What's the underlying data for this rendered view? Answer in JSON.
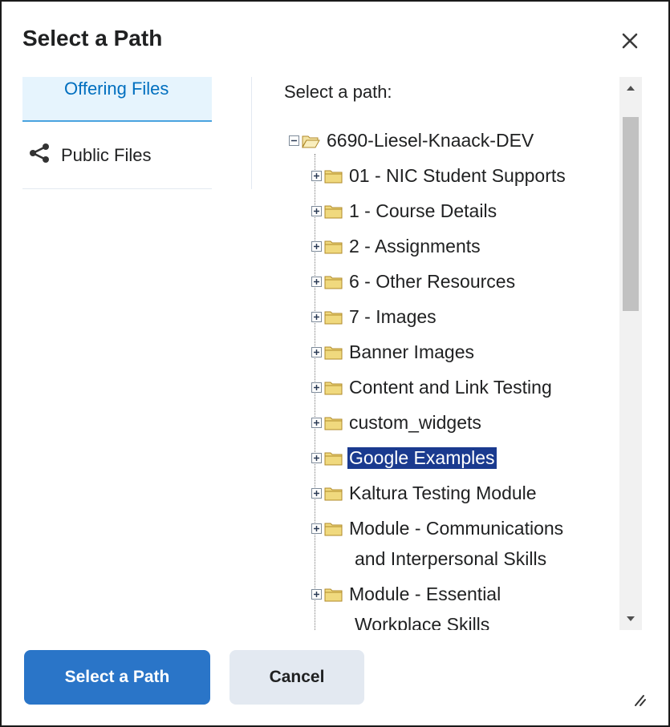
{
  "dialog": {
    "title": "Select a Path",
    "close_icon": "close-icon"
  },
  "nav": {
    "items": [
      {
        "label": "Offering Files",
        "active": true
      },
      {
        "label": "Public Files",
        "icon": "share-icon"
      }
    ]
  },
  "tree": {
    "prompt": "Select a path:",
    "root": "6690-Liesel-Knaack-DEV",
    "folders": [
      "01 - NIC Student Supports",
      "1 - Course Details",
      "2 - Assignments",
      "6 - Other Resources",
      "7 - Images",
      "Banner Images",
      "Content and Link Testing",
      "custom_widgets",
      "Google Examples",
      "Kaltura Testing Module",
      "Module - Communications",
      "Module - Essential"
    ],
    "folder_continuations": {
      "module_communications": "and Interpersonal Skills",
      "module_essential": "Workplace Skills"
    },
    "selected": "Google Examples"
  },
  "footer": {
    "primary_label": "Select a Path",
    "cancel_label": "Cancel"
  },
  "colors": {
    "primary": "#2a75c8",
    "selection": "#1a3a8f",
    "active_tab_bg": "#e6f4fd",
    "active_tab_text": "#006fbf"
  }
}
